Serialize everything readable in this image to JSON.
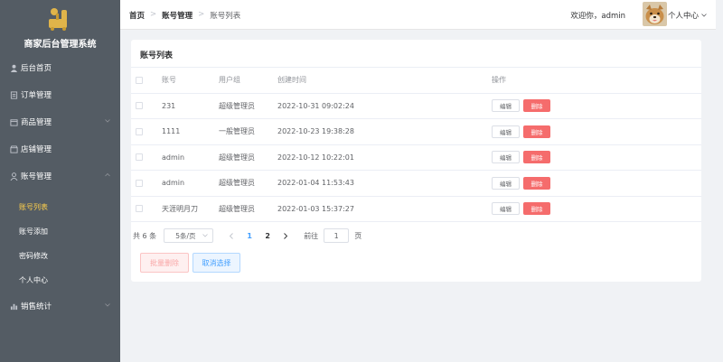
{
  "sidebar": {
    "title": "商家后台管理系统",
    "items": [
      {
        "label": "后台首页",
        "icon": "user-icon"
      },
      {
        "label": "订单管理",
        "icon": "document-icon"
      },
      {
        "label": "商品管理",
        "icon": "box-icon"
      },
      {
        "label": "店铺管理",
        "icon": "shop-icon"
      },
      {
        "label": "账号管理",
        "icon": "person-icon"
      },
      {
        "label": "销售统计",
        "icon": "chart-icon"
      }
    ],
    "subitems": [
      {
        "label": "账号列表",
        "active": true
      },
      {
        "label": "账号添加"
      },
      {
        "label": "密码修改"
      },
      {
        "label": "个人中心"
      }
    ]
  },
  "header": {
    "breadcrumb": [
      "首页",
      "账号管理",
      "账号列表"
    ],
    "sep": ">",
    "welcome": "欢迎你，admin",
    "user_menu": "个人中心"
  },
  "card": {
    "title": "账号列表",
    "columns": {
      "account": "账号",
      "group": "用户组",
      "created": "创建时间",
      "actions": "操作"
    },
    "rows": [
      {
        "account": "231",
        "group": "超级管理员",
        "created": "2022-10-31 09:02:24"
      },
      {
        "account": "1111",
        "group": "一般管理员",
        "created": "2022-10-23 19:38:28"
      },
      {
        "account": "admin",
        "group": "超级管理员",
        "created": "2022-10-12 10:22:01"
      },
      {
        "account": "admin",
        "group": "超级管理员",
        "created": "2022-01-04 11:53:43"
      },
      {
        "account": "天涯明月刀",
        "group": "超级管理员",
        "created": "2022-01-03 15:37:27"
      }
    ],
    "edit_label": "编辑",
    "delete_label": "删除"
  },
  "pagination": {
    "total": "共 6 条",
    "page_size": "5条/页",
    "pages": [
      "1",
      "2"
    ],
    "current": "1",
    "goto_label": "前往",
    "goto_value": "1",
    "page_unit": "页"
  },
  "actions": {
    "batch_delete": "批量删除",
    "cancel_select": "取消选择"
  },
  "colors": {
    "sidebar_bg": "#545c64",
    "active_text": "#ffd04b",
    "primary": "#409eff",
    "danger": "#f56c6c"
  }
}
